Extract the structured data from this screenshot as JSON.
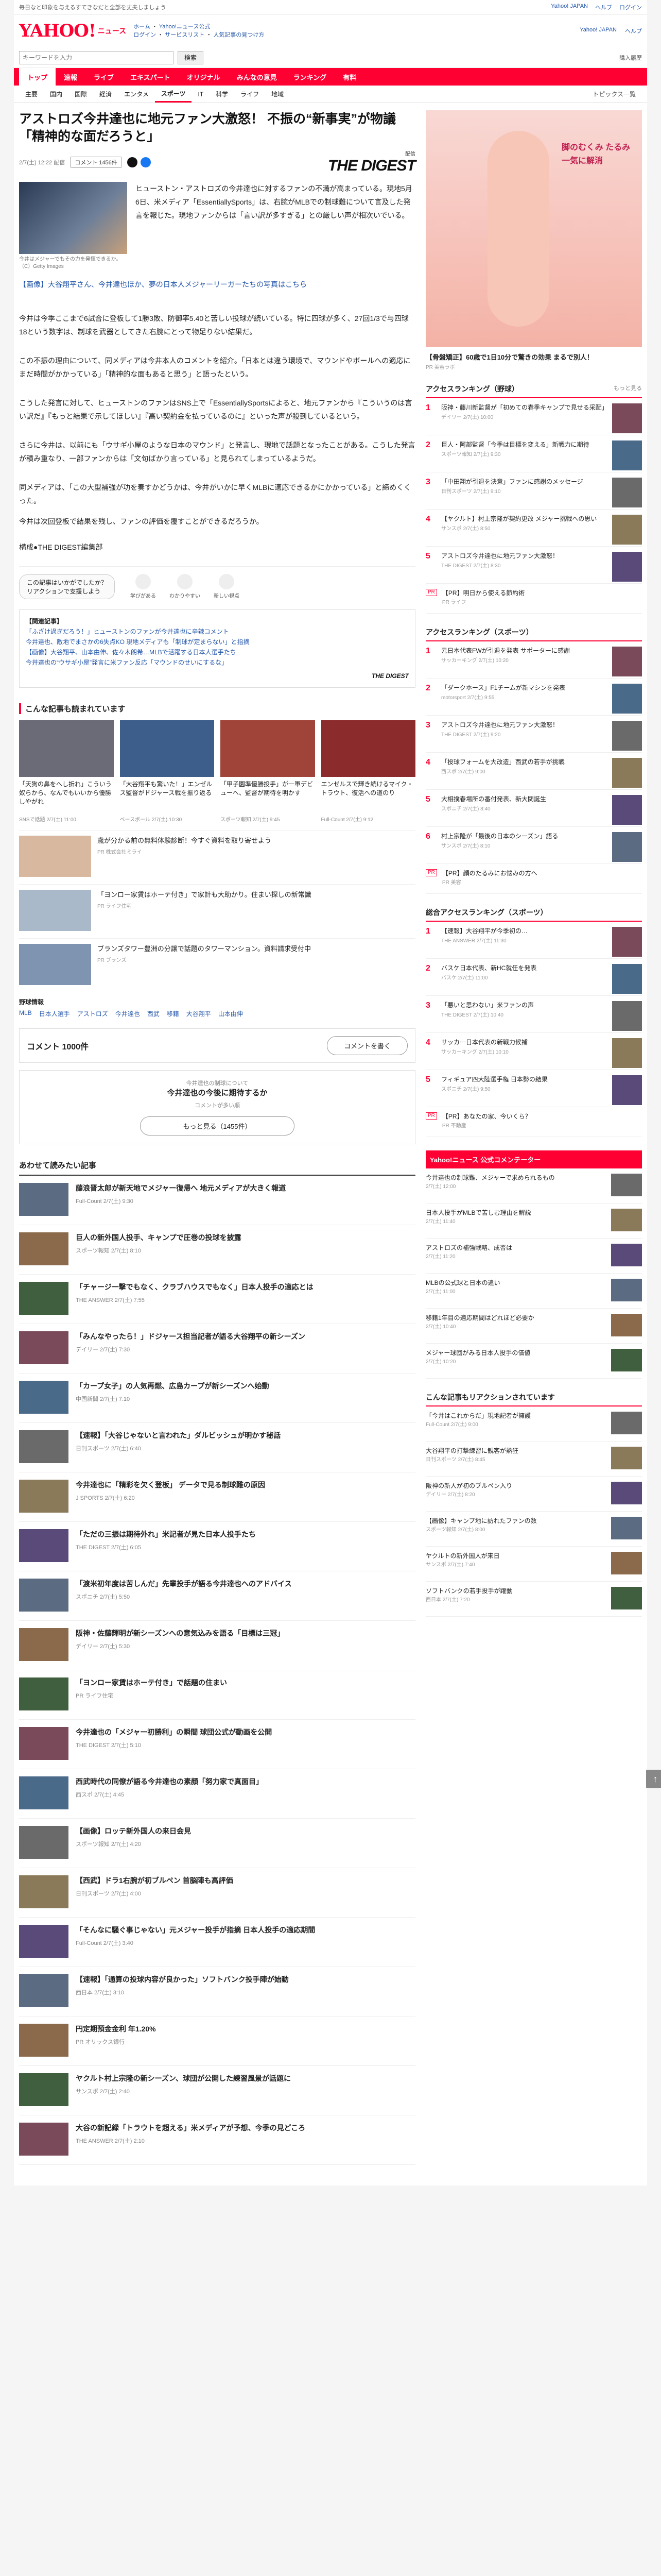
{
  "topbar": {
    "left": "毎日なと印象を与えるすてきなだと全部を丈夫しましょう",
    "links": [
      "Yahoo! JAPAN",
      "ヘルプ",
      "ログイン"
    ]
  },
  "header": {
    "logo": "YAHOO!",
    "logo_sub": "ニュース",
    "links": [
      "ホーム",
      "Yahoo!ニュース公式",
      "ログイン",
      "サービスリスト",
      "人気記事の見つけ方"
    ],
    "right": [
      "Yahoo! JAPAN",
      "ヘルプ"
    ]
  },
  "search": {
    "placeholder": "キーワードを入力",
    "button": "検索",
    "extra": "購入履歴"
  },
  "gnav": {
    "items": [
      "トップ",
      "速報",
      "ライブ",
      "エキスパート",
      "オリジナル",
      "みんなの意見",
      "ランキング",
      "有料"
    ],
    "active": 0
  },
  "subnav": {
    "items": [
      "主要",
      "国内",
      "国際",
      "経済",
      "エンタメ",
      "スポーツ",
      "IT",
      "科学",
      "ライフ",
      "地域"
    ],
    "active": 5,
    "topics": "トピックス一覧"
  },
  "article": {
    "title": "アストロズ今井達也に地元ファン大激怒！ 不振の“新事実”が物議「精神的な面だろうと」",
    "date": "2/7(土) 12:22 配信",
    "comments_pill": "コメント 1456件",
    "digest_label": "THE DIGEST",
    "source_small": "配信",
    "photo_caption": "今井はメジャーでもその力を発揮できるか。（C）Getty Images",
    "paragraphs": [
      "ヒューストン・アストロズの今井達也に対するファンの不満が高まっている。現地5月6日、米メディア「EssentiallySports」は、右腕がMLBでの制球難について言及した発言を報じた。現地ファンからは「言い訳が多すぎる」との厳しい声が相次いでいる。",
      "【画像】大谷翔平さん、今井達也ほか、夢の日本人メジャーリーガーたちの写真はこちら",
      "今井は今季ここまで6試合に登板して1勝3敗、防御率5.40と苦しい投球が続いている。特に四球が多く、27回1/3で与四球18という数字は、制球を武器としてきた右腕にとって物足りない結果だ。",
      "この不振の理由について、同メディアは今井本人のコメントを紹介。「日本とは違う環境で、マウンドやボールへの適応にまだ時間がかかっている」「精神的な面もあると思う」と語ったという。",
      "こうした発言に対して、ヒューストンのファンはSNS上で「EssentiallySportsによると、地元ファンから『こういうのは言い訳だ』『もっと結果で示してほしい』『高い契約金を払っているのに』といった声が殺到しているという。",
      "さらに今井は、以前にも「ウサギ小屋のような日本のマウンド」と発言し、現地で話題となったことがある。こうした発言が積み重なり、一部ファンからは「文句ばかり言っている」と見られてしまっているようだ。",
      "同メディアは、「この大型補強が功を奏すかどうかは、今井がいかに早くMLBに適応できるかにかかっている」と締めくくった。",
      "今井は次回登板で結果を残し、ファンの評価を覆すことができるだろうか。",
      "構成●THE DIGEST編集部"
    ],
    "related": [
      "【関連記事】",
      "「ふざけ過ぎだろう！」ヒューストンのファンが今井達也に辛辣コメント",
      "今井達也、敵地でまさかの6失点KO 現地メディアも「制球が定まらない」と指摘",
      "【画像】大谷翔平、山本由伸、佐々木朗希…MLBで活躍する日本人選手たち",
      "今井達也の“ウサギ小屋”発言に米ファン反応「マウンドのせいにするな」"
    ],
    "like_btn": "この記事はいかがでしたか？\nリアクションで支援しよう",
    "reactions": [
      "学びがある",
      "わかりやすい",
      "新しい視点"
    ],
    "author_source": "THE DIGEST"
  },
  "more_section": {
    "title": "こんな記事も読まれています",
    "cards": [
      {
        "title": "「天狗の鼻をへし折れ」こういう奴らから、なんでもいいから優勝しやがれ",
        "src": "SNSで話題 2/7(土) 11:00"
      },
      {
        "title": "「大谷翔平も驚いた！」エンゼルス監督がドジャース戦を振り返る",
        "src": "ベースボール 2/7(土) 10:30"
      },
      {
        "title": "「甲子園準優勝投手」が一軍デビューへ、監督が期待を明かす",
        "src": "スポーツ報知 2/7(土) 9:45"
      },
      {
        "title": "エンゼルスで輝き続けるマイク・トラウト、復活への道のり",
        "src": "Full-Count 2/7(土) 9:12"
      }
    ]
  },
  "ads": [
    {
      "title": "歳が分かる前の無料体験診断！今すぐ資料を取り寄せよう",
      "src": "PR 株式会社ミライ"
    },
    {
      "title": "「ヨンロー家賃はホーテ付き」で家計も大助かり。住まい探しの新常識",
      "src": "PR ライフ住宅"
    },
    {
      "title": "ブランズタワー豊洲の分譲で話題のタワーマンション。資料請求受付中",
      "src": "PR ブランズ"
    }
  ],
  "keywords": {
    "label": "野球情報",
    "items": [
      "MLB",
      "日本人選手",
      "アストロズ",
      "今井達也",
      "西武",
      "移籍",
      "大谷翔平",
      "山本由伸"
    ]
  },
  "comments": {
    "label": "コメント 1000件",
    "post": "コメントを書く",
    "sample_label": "今井達也の制球について",
    "sample_q": "今井達也の今後に期待するか",
    "sample_sub": "コメントが多い順",
    "more": "もっと見る（1455件）"
  },
  "also_read": {
    "title": "あわせて読みたい記事",
    "items": [
      {
        "title": "藤浪晋太郎が新天地でメジャー復帰へ 地元メディアが大きく報道",
        "src": "Full-Count 2/7(土) 9:30"
      },
      {
        "title": "巨人の新外国人投手、キャンプで圧巻の投球を披露",
        "src": "スポーツ報知 2/7(土) 8:10"
      },
      {
        "title": "「チャージ一撃でもなく、クラブハウスでもなく」日本人投手の適応とは",
        "src": "THE ANSWER 2/7(土) 7:55"
      },
      {
        "title": "「みんなやったら！」ドジャース担当記者が語る大谷翔平の新シーズン",
        "src": "デイリー 2/7(土) 7:30"
      },
      {
        "title": "「カープ女子」の人気再燃、広島カープが新シーズンへ始動",
        "src": "中国新聞 2/7(土) 7:10"
      },
      {
        "title": "【速報】「大谷じゃないと言われた」ダルビッシュが明かす秘話",
        "src": "日刊スポーツ 2/7(土) 6:40"
      },
      {
        "title": "今井達也に「精彩を欠く登板」 データで見る制球難の原因",
        "src": "J SPORTS 2/7(土) 6:20"
      },
      {
        "title": "「ただの三振は期待外れ」米記者が見た日本人投手たち",
        "src": "THE DIGEST 2/7(土) 6:05"
      },
      {
        "title": "「渡米初年度は苦しんだ」先輩投手が語る今井達也へのアドバイス",
        "src": "スポニチ 2/7(土) 5:50"
      },
      {
        "title": "阪神・佐藤輝明が新シーズンへの意気込みを語る「目標は三冠」",
        "src": "デイリー 2/7(土) 5:30"
      },
      {
        "title": "「ヨンロー家賃はホーテ付き」で話題の住まい",
        "src": "PR ライフ住宅"
      },
      {
        "title": "今井達也の「メジャー初勝利」の瞬間 球団公式が動画を公開",
        "src": "THE DIGEST 2/7(土) 5:10"
      },
      {
        "title": "西武時代の同僚が語る今井達也の素顔「努力家で真面目」",
        "src": "西スポ 2/7(土) 4:45"
      },
      {
        "title": "【画像】ロッテ新外国人の来日会見",
        "src": "スポーツ報知 2/7(土) 4:20"
      },
      {
        "title": "【西武】ドラ1右腕が初ブルペン 首脳陣も高評価",
        "src": "日刊スポーツ 2/7(土) 4:00"
      },
      {
        "title": "「そんなに騒ぐ事じゃない」元メジャー投手が指摘 日本人投手の適応期間",
        "src": "Full-Count 2/7(土) 3:40"
      },
      {
        "title": "【速報】「通算の投球内容が良かった」ソフトバンク投手陣が始動",
        "src": "西日本 2/7(土) 3:10"
      },
      {
        "title": "円定期預金金利 年1.20%",
        "src": "PR オリックス銀行"
      },
      {
        "title": "ヤクルト村上宗隆の新シーズン、球団が公開した練習風景が話題に",
        "src": "サンスポ 2/7(土) 2:40"
      },
      {
        "title": "大谷の新記録「トラウトを超える」米メディアが予想、今季の見どころ",
        "src": "THE ANSWER 2/7(土) 2:10"
      }
    ]
  },
  "side": {
    "ad_text": "脚のむくみ たるみ 一気に解消",
    "ad_caption": "【骨盤矯正】60歳で1日10分で驚きの効果 まるで別人！",
    "ad_src": "PR 美容ラボ",
    "rank1_title": "アクセスランキング（野球）",
    "rank1_x": "もっと見る",
    "rank1": [
      {
        "title": "阪神・藤川新監督が「初めての春季キャンプで見せる采配」",
        "src": "デイリー 2/7(土) 10:00"
      },
      {
        "title": "巨人・阿部監督「今季は目標を変える」新戦力に期待",
        "src": "スポーツ報知 2/7(土) 9:30"
      },
      {
        "title": "「中田翔が引退を決意」ファンに感謝のメッセージ",
        "src": "日刊スポーツ 2/7(土) 9:10"
      },
      {
        "title": "【ヤクルト】村上宗隆が契約更改 メジャー挑戦への思い",
        "src": "サンスポ 2/7(土) 8:50"
      },
      {
        "title": "アストロズ今井達也に地元ファン大激怒！",
        "src": "THE DIGEST 2/7(土) 8:30"
      }
    ],
    "pr1": {
      "title": "【PR】明日から使える節約術",
      "src": "PR ライフ"
    },
    "rank2_title": "アクセスランキング（スポーツ）",
    "rank2": [
      {
        "title": "元日本代表FWが引退を発表 サポーターに感謝",
        "src": "サッカーキング 2/7(土) 10:20"
      },
      {
        "title": "「ダークホース」F1チームが新マシンを発表",
        "src": "motorsport 2/7(土) 9:55"
      },
      {
        "title": "アストロズ今井達也に地元ファン大激怒！",
        "src": "THE DIGEST 2/7(土) 9:20"
      },
      {
        "title": "「投球フォームを大改造」西武の若手が挑戦",
        "src": "西スポ 2/7(土) 9:00"
      },
      {
        "title": "大相撲春場所の番付発表、新大関誕生",
        "src": "スポニチ 2/7(土) 8:40"
      },
      {
        "title": "村上宗隆が「最後の日本のシーズン」語る",
        "src": "サンスポ 2/7(土) 8:10"
      }
    ],
    "pr2": {
      "title": "【PR】顔のたるみにお悩みの方へ",
      "src": "PR 美容"
    },
    "rank3_title": "総合アクセスランキング（スポーツ）",
    "rank3": [
      {
        "title": "【速報】大谷翔平が今季初の…",
        "src": "THE ANSWER 2/7(土) 11:30"
      },
      {
        "title": "バスケ日本代表、新HC就任を発表",
        "src": "バスケ 2/7(土) 11:00"
      },
      {
        "title": "「悪いと思わない」米ファンの声",
        "src": "THE DIGEST 2/7(土) 10:40"
      },
      {
        "title": "サッカー日本代表の新戦力候補",
        "src": "サッカーキング 2/7(土) 10:10"
      },
      {
        "title": "フィギュア四大陸選手権 日本勢の結果",
        "src": "スポニチ 2/7(土) 9:50"
      }
    ],
    "pr3": {
      "title": "【PR】あなたの家、今いくら？",
      "src": "PR 不動産"
    },
    "yh_title": "Yahoo!ニュース 公式コメンテーター",
    "yh": [
      {
        "title": "今井達也の制球難、メジャーで求められるもの",
        "src": "2/7(土) 12:00"
      },
      {
        "title": "日本人投手がMLBで苦しむ理由を解説",
        "src": "2/7(土) 11:40"
      },
      {
        "title": "アストロズの補強戦略、成否は",
        "src": "2/7(土) 11:20"
      },
      {
        "title": "MLBの公式球と日本の違い",
        "src": "2/7(土) 11:00"
      },
      {
        "title": "移籍1年目の適応期間はどれほど必要か",
        "src": "2/7(土) 10:40"
      },
      {
        "title": "メジャー球団がみる日本人投手の価値",
        "src": "2/7(土) 10:20"
      }
    ],
    "rec_title": "こんな記事もリアクションされています",
    "rec": [
      {
        "title": "「今井はこれからだ」現地記者が擁護",
        "src": "Full-Count 2/7(土) 9:00"
      },
      {
        "title": "大谷翔平の打撃練習に観客が熱狂",
        "src": "日刊スポーツ 2/7(土) 8:45"
      },
      {
        "title": "阪神の新人が初のブルペン入り",
        "src": "デイリー 2/7(土) 8:20"
      },
      {
        "title": "【画像】キャンプ地に訪れたファンの数",
        "src": "スポーツ報知 2/7(土) 8:00"
      },
      {
        "title": "ヤクルトの新外国人が来日",
        "src": "サンスポ 2/7(土) 7:40"
      },
      {
        "title": "ソフトバンクの若手投手が躍動",
        "src": "西日本 2/7(土) 7:20"
      }
    ]
  },
  "to_top": "↑"
}
